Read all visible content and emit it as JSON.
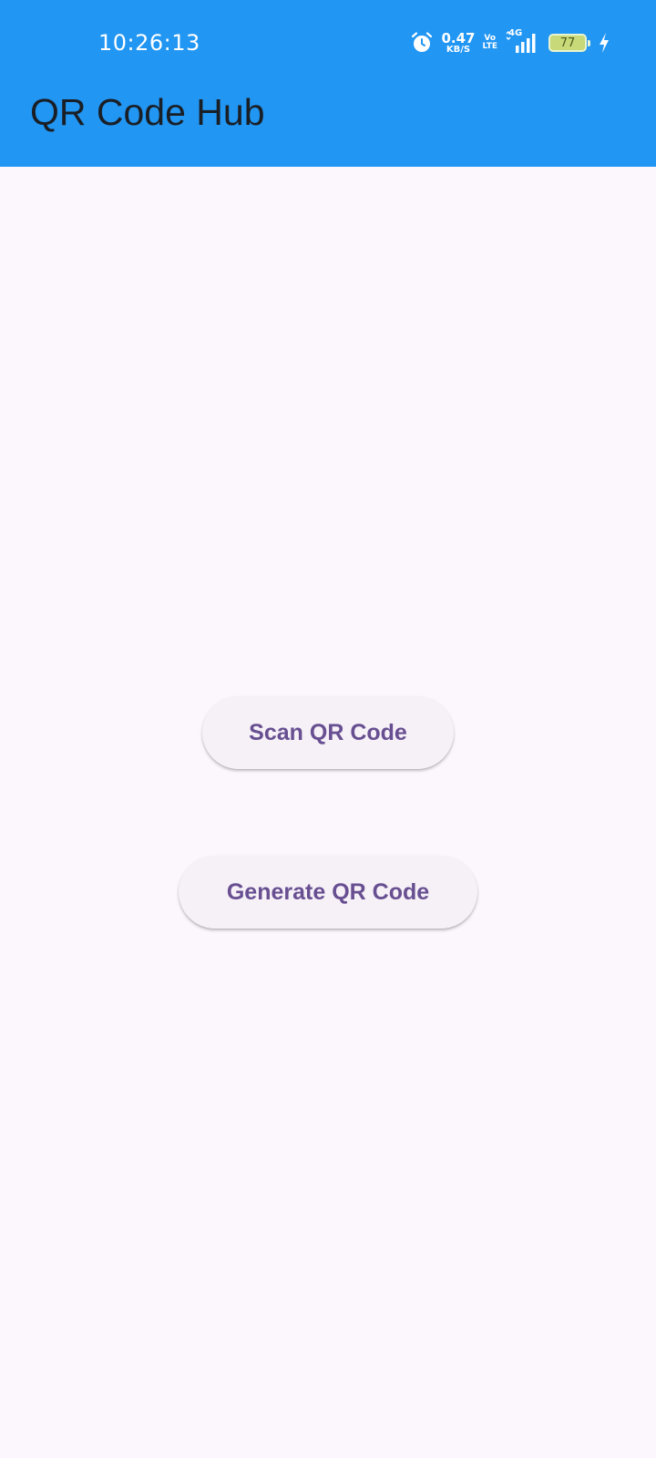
{
  "status_bar": {
    "time": "10:26:13",
    "net_speed_value": "0.47",
    "net_speed_unit": "KB/S",
    "volte_top": "Vo",
    "volte_bottom": "LTE",
    "network_type": "4G",
    "battery_level": "77",
    "icons": [
      "alarm-icon",
      "volte-icon",
      "signal-icon",
      "battery-icon",
      "charging-icon"
    ]
  },
  "app_bar": {
    "title": "QR Code Hub",
    "color": "#2196f3"
  },
  "main": {
    "scan_button_label": "Scan QR Code",
    "generate_button_label": "Generate QR Code",
    "button_text_color": "#674f91",
    "background_color": "#fcf7fd"
  }
}
